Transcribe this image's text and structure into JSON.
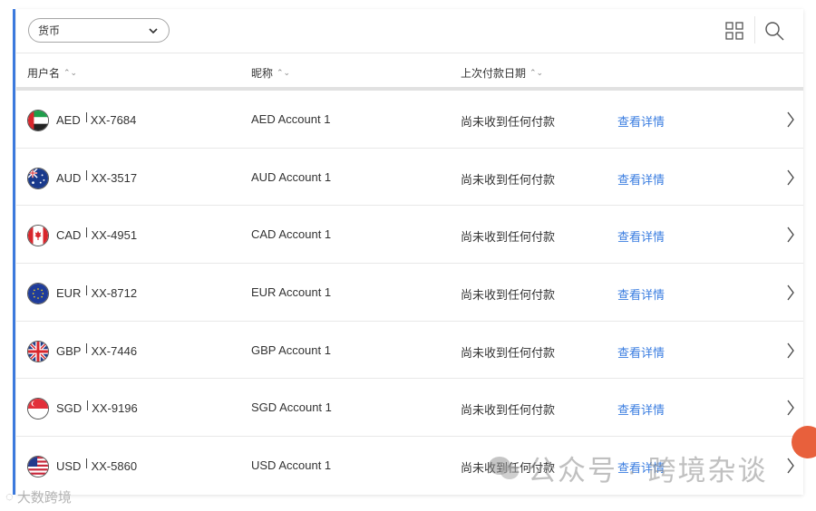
{
  "toolbar": {
    "currency_select": "货币"
  },
  "table": {
    "headers": {
      "username": "用户名",
      "nickname": "昵称",
      "last_payment": "上次付款日期"
    },
    "rows": [
      {
        "code": "AED",
        "account": "XX-7684",
        "nickname": "AED Account 1",
        "status": "尚未收到任何付款",
        "link": "查看详情"
      },
      {
        "code": "AUD",
        "account": "XX-3517",
        "nickname": "AUD Account 1",
        "status": "尚未收到任何付款",
        "link": "查看详情"
      },
      {
        "code": "CAD",
        "account": "XX-4951",
        "nickname": "CAD Account 1",
        "status": "尚未收到任何付款",
        "link": "查看详情"
      },
      {
        "code": "EUR",
        "account": "XX-8712",
        "nickname": "EUR Account 1",
        "status": "尚未收到任何付款",
        "link": "查看详情"
      },
      {
        "code": "GBP",
        "account": "XX-7446",
        "nickname": "GBP Account 1",
        "status": "尚未收到任何付款",
        "link": "查看详情"
      },
      {
        "code": "SGD",
        "account": "XX-9196",
        "nickname": "SGD Account 1",
        "status": "尚未收到任何付款",
        "link": "查看详情"
      },
      {
        "code": "USD",
        "account": "XX-5860",
        "nickname": "USD Account 1",
        "status": "尚未收到任何付款",
        "link": "查看详情"
      }
    ]
  },
  "watermarks": {
    "right": "公众号 · 跨境杂谈",
    "left": "大数跨境"
  },
  "colors": {
    "accent": "#3d7be0",
    "link": "#3a7de0",
    "fab": "#e8603c"
  }
}
